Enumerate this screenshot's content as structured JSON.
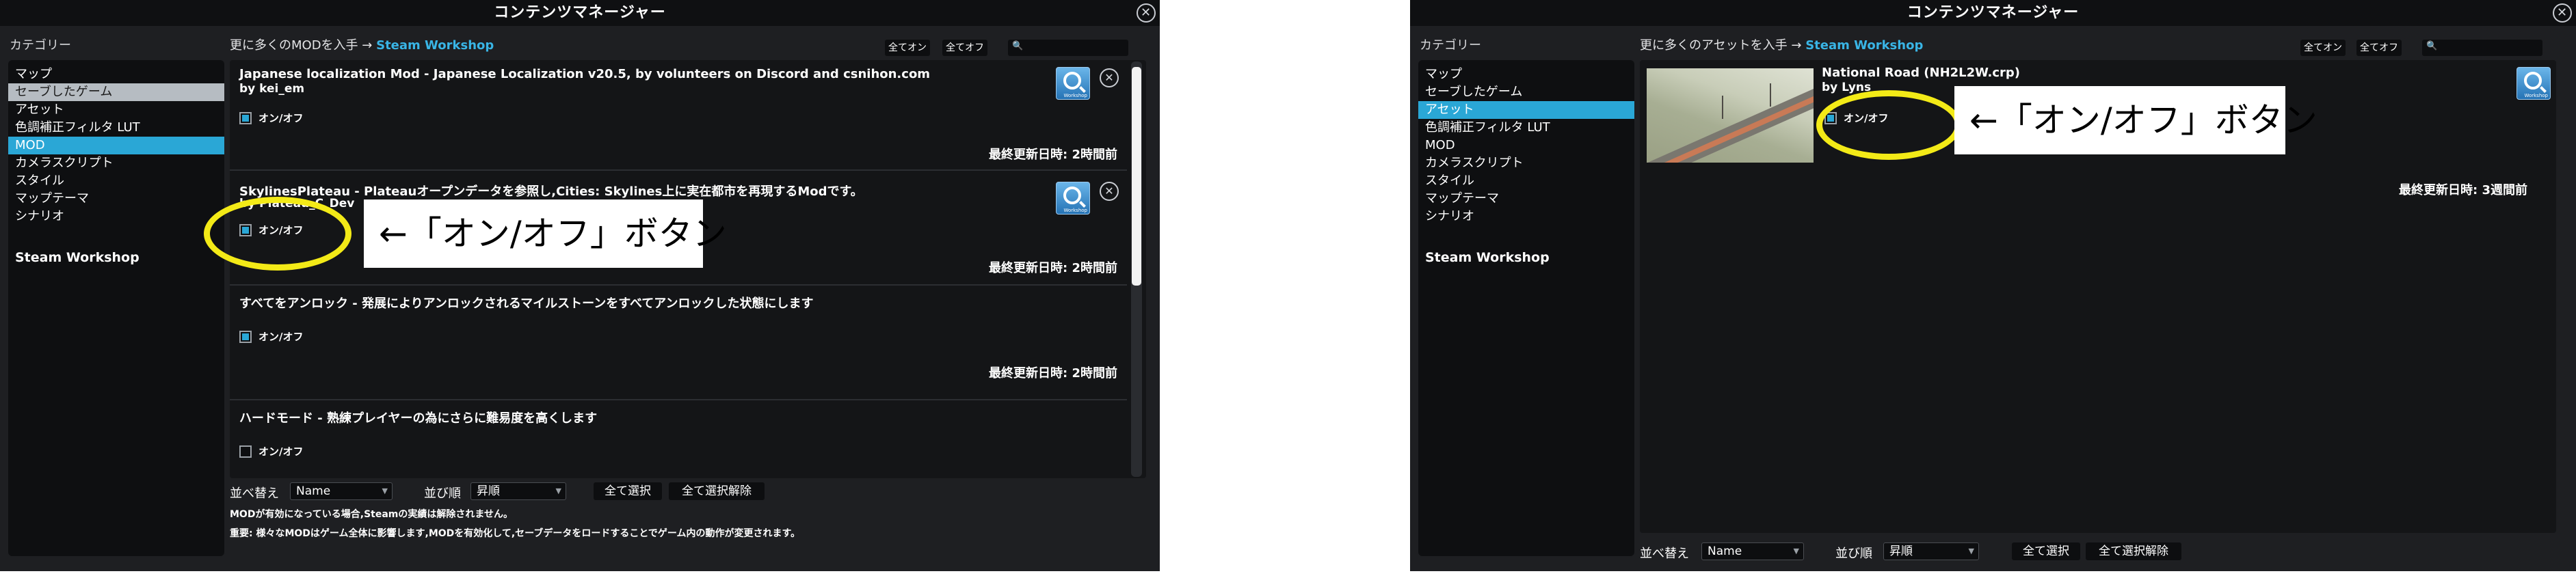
{
  "left": {
    "title": "コンテンツマネージャー",
    "category_heading": "カテゴリー",
    "categories": [
      "マップ",
      "セーブしたゲーム",
      "アセット",
      "色調補正フィルタ LUT",
      "MOD",
      "カメラスクリプト",
      "スタイル",
      "マップテーマ",
      "シナリオ"
    ],
    "active_category": "MOD",
    "highlighted_category": "セーブしたゲーム",
    "steam_workshop": "Steam Workshop",
    "workshop_prefix": "更に多くのMODを入手 →",
    "workshop_link": "Steam Workshop",
    "all_on": "全てオン",
    "all_off": "全てオフ",
    "mods": [
      {
        "title": "Japanese localization Mod - Japanese Localization v20.5, by volunteers on Discord and csnihon.com",
        "author": "by kei_em",
        "toggle": "オン/オフ",
        "enabled": true,
        "updated": "最終更新日時: 2時間前"
      },
      {
        "title": "SkylinesPlateau - Plateauオープンデータを参照し,Cities: Skylines上に実在都市を再現するModです。",
        "author": "by Plateau_C_Dev",
        "toggle": "オン/オフ",
        "enabled": true,
        "updated": "最終更新日時: 2時間前"
      },
      {
        "title": "すべてをアンロック - 発展によりアンロックされるマイルストーンをすべてアンロックした状態にします",
        "author": "",
        "toggle": "オン/オフ",
        "enabled": true,
        "updated": "最終更新日時: 2時間前"
      },
      {
        "title": "ハードモード - 熟練プレイヤーの為にさらに難易度を高くします",
        "author": "",
        "toggle": "オン/オフ",
        "enabled": false,
        "updated": ""
      }
    ],
    "sort_label": "並べ替え",
    "sort_value": "Name",
    "order_label": "並び順",
    "order_value": "昇順",
    "select_all": "全て選択",
    "deselect_all": "全て選択解除",
    "notice1": "MODが有効になっている場合,Steamの実績は解除されません。",
    "notice2": "重要: 様々なMODはゲーム全体に影響します,MODを有効化して,セーブデータをロードすることでゲーム内の動作が変更されます。",
    "callout": "←「オン/オフ」ボタン"
  },
  "right": {
    "title": "コンテンツマネージャー",
    "category_heading": "カテゴリー",
    "categories": [
      "マップ",
      "セーブしたゲーム",
      "アセット",
      "色調補正フィルタ LUT",
      "MOD",
      "カメラスクリプト",
      "スタイル",
      "マップテーマ",
      "シナリオ"
    ],
    "active_category": "アセット",
    "steam_workshop": "Steam Workshop",
    "workshop_prefix": "更に多くのアセットを入手 →",
    "workshop_link": "Steam Workshop",
    "all_on": "全てオン",
    "all_off": "全てオフ",
    "asset": {
      "title": "National Road (NH2L2W.crp)",
      "author": "by Lyns",
      "toggle": "オン/オフ",
      "enabled": true,
      "updated": "最終更新日時: 3週間前"
    },
    "sort_label": "並べ替え",
    "sort_value": "Name",
    "order_label": "並び順",
    "order_value": "昇順",
    "select_all": "全て選択",
    "deselect_all": "全て選択解除",
    "callout": "←「オン/オフ」ボタン"
  },
  "colors": {
    "accent": "#2aa7d6",
    "link": "#39b5e6",
    "highlight": "#f3ea17"
  },
  "icons": {
    "workshop": "magnifier-icon",
    "close": "close-x-icon",
    "unsubscribe": "x-circle-icon"
  }
}
